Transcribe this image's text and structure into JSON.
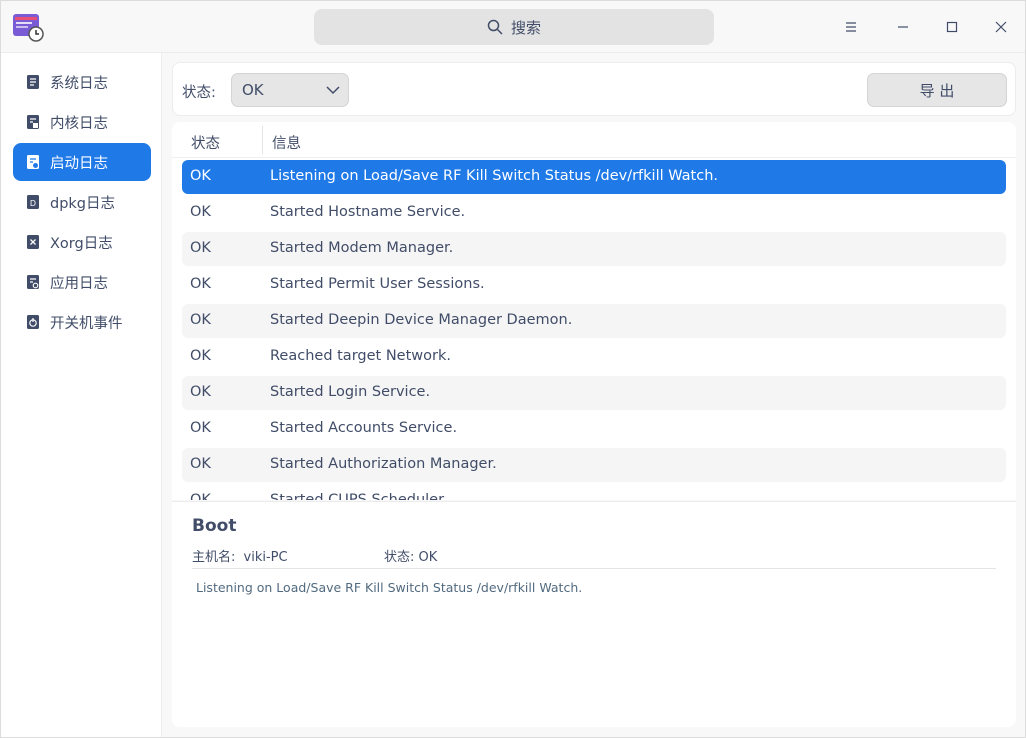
{
  "titlebar": {
    "search_label": "搜索"
  },
  "sidebar": {
    "items": [
      {
        "label": "系统日志",
        "icon": "system-log-icon"
      },
      {
        "label": "内核日志",
        "icon": "kernel-log-icon"
      },
      {
        "label": "启动日志",
        "icon": "boot-log-icon",
        "active": true
      },
      {
        "label": "dpkg日志",
        "icon": "dpkg-log-icon"
      },
      {
        "label": "Xorg日志",
        "icon": "xorg-log-icon"
      },
      {
        "label": "应用日志",
        "icon": "app-log-icon"
      },
      {
        "label": "开关机事件",
        "icon": "power-event-icon"
      }
    ]
  },
  "filter": {
    "status_label": "状态:",
    "status_value": "OK",
    "export_label": "导 出"
  },
  "table": {
    "columns": [
      "状态",
      "信息"
    ],
    "rows": [
      {
        "status": "OK",
        "info": "Listening on Load/Save RF Kill Switch Status /dev/rfkill Watch."
      },
      {
        "status": "OK",
        "info": "Started Hostname Service."
      },
      {
        "status": "OK",
        "info": "Started Modem Manager."
      },
      {
        "status": "OK",
        "info": "Started Permit User Sessions."
      },
      {
        "status": "OK",
        "info": "Started Deepin Device Manager Daemon."
      },
      {
        "status": "OK",
        "info": "Reached target Network."
      },
      {
        "status": "OK",
        "info": "Started Login Service."
      },
      {
        "status": "OK",
        "info": "Started Accounts Service."
      },
      {
        "status": "OK",
        "info": "Started Authorization Manager."
      },
      {
        "status": "OK",
        "info": "Started CUPS Scheduler."
      }
    ]
  },
  "detail": {
    "title": "Boot",
    "hostname_label": "主机名:",
    "hostname_value": "viki-PC",
    "status_label": "状态:",
    "status_value": "OK",
    "message": "Listening on Load/Save RF Kill Switch Status /dev/rfkill Watch."
  },
  "colors": {
    "accent": "#1f7ae8",
    "text": "#414d68"
  }
}
